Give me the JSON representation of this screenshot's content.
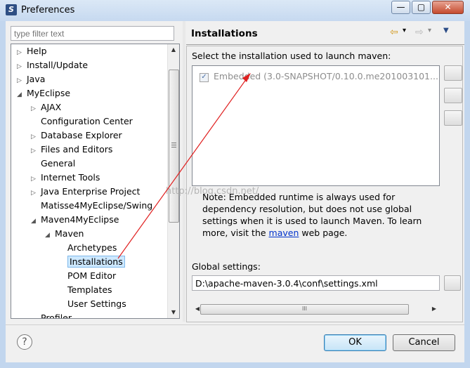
{
  "window": {
    "title": "Preferences",
    "app_icon": "S",
    "controls": {
      "minimize": "—",
      "maximize": "▢",
      "close": "✕"
    }
  },
  "left": {
    "filter_placeholder": "type filter text",
    "tree": [
      {
        "label": "Help",
        "expander": "▷"
      },
      {
        "label": "Install/Update",
        "expander": "▷"
      },
      {
        "label": "Java",
        "expander": "▷"
      },
      {
        "label": "MyEclipse",
        "expander": "◢"
      },
      {
        "label": "AJAX",
        "expander": "▷"
      },
      {
        "label": "Configuration Center",
        "expander": ""
      },
      {
        "label": "Database Explorer",
        "expander": "▷"
      },
      {
        "label": "Files and Editors",
        "expander": "▷"
      },
      {
        "label": "General",
        "expander": ""
      },
      {
        "label": "Internet Tools",
        "expander": "▷"
      },
      {
        "label": "Java Enterprise Project",
        "expander": "▷"
      },
      {
        "label": "Matisse4MyEclipse/Swing",
        "expander": ""
      },
      {
        "label": "Maven4MyEclipse",
        "expander": "◢"
      },
      {
        "label": "Maven",
        "expander": "◢"
      },
      {
        "label": "Archetypes",
        "expander": ""
      },
      {
        "label": "Installations",
        "expander": ""
      },
      {
        "label": "POM Editor",
        "expander": ""
      },
      {
        "label": "Templates",
        "expander": ""
      },
      {
        "label": "User Settings",
        "expander": ""
      },
      {
        "label": "Profiler",
        "expander": ""
      }
    ],
    "selected_item": "Installations"
  },
  "right": {
    "title": "Installations",
    "nav": {
      "back_icon": "⇦",
      "back_menu": "▾",
      "forward_icon": "⇨",
      "forward_menu": "▾",
      "view_menu": "▼"
    },
    "select_label": "Select the installation used to launch maven:",
    "installations": [
      {
        "checked": true,
        "check_mark": "✓",
        "name": "Embedded (3.0-SNAPSHOT/0.10.0.me201003101..."
      }
    ],
    "note_pre": "Note: Embedded runtime is always used for dependency resolution, but does not use global settings when it is used to launch Maven. To learn more, visit the ",
    "note_link": "maven",
    "note_post": " web page.",
    "global_label": "Global settings:",
    "global_value": "D:\\apache-maven-3.0.4\\conf\\settings.xml",
    "hscroll_grip": "III"
  },
  "scroll_arrows": {
    "up": "▲",
    "down": "▼",
    "left": "◀",
    "right": "▶"
  },
  "footer": {
    "help": "?",
    "ok": "OK",
    "cancel": "Cancel"
  },
  "watermark": "http://blog.csdn.net/",
  "colors": {
    "arrow": "#e02020",
    "selection": "#cde8ff",
    "link": "#0033cc"
  }
}
